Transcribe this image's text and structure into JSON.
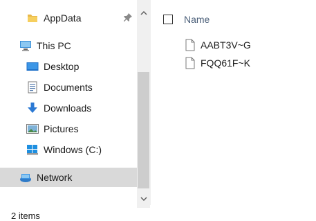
{
  "navigation": {
    "quick_access": {
      "label": "AppData",
      "icon": "folder-icon"
    },
    "this_pc": {
      "label": "This PC",
      "icon": "computer-icon"
    },
    "items": [
      {
        "label": "Desktop",
        "icon": "desktop-icon"
      },
      {
        "label": "Documents",
        "icon": "documents-icon"
      },
      {
        "label": "Downloads",
        "icon": "downloads-icon"
      },
      {
        "label": "Pictures",
        "icon": "pictures-icon"
      },
      {
        "label": "Windows (C:)",
        "icon": "drive-icon"
      }
    ],
    "network": {
      "label": "Network",
      "icon": "network-icon",
      "selected": true
    }
  },
  "content": {
    "column_header": "Name",
    "files": [
      {
        "name": "AABT3V~G",
        "icon": "file-icon"
      },
      {
        "name": "FQQ61F~K",
        "icon": "file-icon"
      }
    ]
  },
  "status": {
    "item_count": "2 items"
  },
  "colors": {
    "selected_bg": "#d9d9d9",
    "header_text": "#4c607a",
    "scrollbar_bg": "#f0f0f0",
    "thumb": "#cdcdcd"
  }
}
